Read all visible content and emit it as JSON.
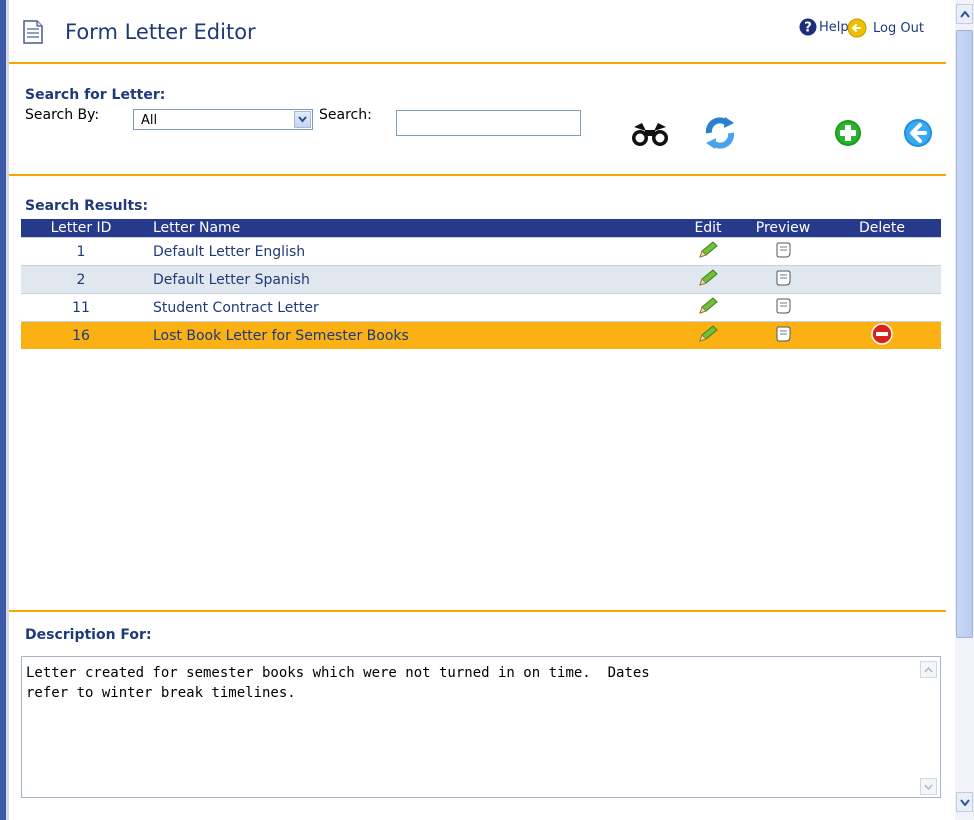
{
  "header": {
    "title": "Form Letter Editor",
    "help_label": "Help",
    "logout_label": "Log Out"
  },
  "search": {
    "section_label": "Search for Letter:",
    "search_by_label": "Search By:",
    "search_by_value": "All",
    "search_label": "Search:",
    "search_value": "",
    "tools": [
      "binoculars-icon",
      "refresh-icon",
      "add-icon",
      "back-icon"
    ]
  },
  "results": {
    "section_label": "Search Results:",
    "columns": {
      "id": "Letter ID",
      "name": "Letter Name",
      "edit": "Edit",
      "preview": "Preview",
      "delete": "Delete"
    },
    "rows": [
      {
        "id": "1",
        "name": "Default Letter English",
        "deletable": false,
        "selected": false
      },
      {
        "id": "2",
        "name": "Default Letter Spanish",
        "deletable": false,
        "selected": false
      },
      {
        "id": "11",
        "name": "Student Contract Letter",
        "deletable": false,
        "selected": false
      },
      {
        "id": "16",
        "name": "Lost Book Letter for Semester Books",
        "deletable": true,
        "selected": true
      }
    ]
  },
  "description": {
    "section_label": "Description For:",
    "text": "Letter created for semester books which were not turned in on time.  Dates\nrefer to winter break timelines."
  },
  "colors": {
    "accent": "#f5a800",
    "header_blue": "#26398a",
    "text_blue": "#1f3a7a",
    "selected_row": "#fbb113"
  }
}
